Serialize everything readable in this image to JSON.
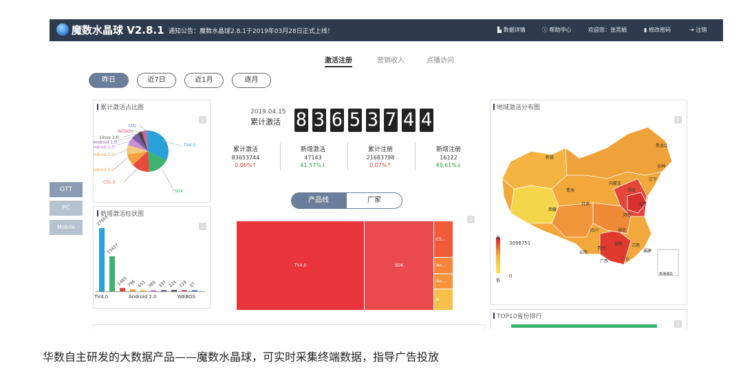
{
  "header": {
    "title": "魔数水晶球 V2.8.1",
    "notice": "通知公告：魔数水晶球2.8.1于2019年03月28日正式上线！",
    "nav": [
      "数据详情",
      "帮助中心",
      "欢迎您：张莞娟",
      "修改密码",
      "注销"
    ]
  },
  "tabs": [
    "激活注册",
    "营销收入",
    "点播访问"
  ],
  "periods": [
    "昨日",
    "近7日",
    "近1月",
    "逐月"
  ],
  "side_tabs": [
    "OTT",
    "PC",
    "Mobile"
  ],
  "pie": {
    "title": "累计激活占比图",
    "labels": [
      "XML",
      "WEBOS",
      "Linux 1.0",
      "Android 1.0",
      "Android 1.3",
      "Android 2.0",
      "Android 3.0",
      "CS1.0",
      "SDK",
      "TV4.0"
    ]
  },
  "bars": {
    "title": "新增激活柱状图",
    "values": [
      "27655",
      "15437",
      "1483",
      "796",
      "651",
      "385",
      "337",
      "224",
      "119",
      "37"
    ],
    "x_labels": [
      "TV4.0",
      "Android 2.0",
      "WEBOS"
    ]
  },
  "counter": {
    "date": "2019.04.15",
    "label": "累计激活",
    "digits": [
      "8",
      "3",
      "6",
      "5",
      "3",
      "7",
      "4",
      "4"
    ]
  },
  "stats": [
    {
      "label": "累计激活",
      "value": "83653744",
      "pct": "0.06%↑"
    },
    {
      "label": "新增激活",
      "value": "47143",
      "pct": "41.57%↓"
    },
    {
      "label": "累计注册",
      "value": "21683798",
      "pct": "0.07%↑"
    },
    {
      "label": "新增注册",
      "value": "16122",
      "pct": "49.61%↓"
    }
  ],
  "toggle": [
    "产品线",
    "厂家"
  ],
  "treemap": [
    "TV4.0",
    "SDK",
    "CS...",
    "An...",
    "An...",
    "A"
  ],
  "map": {
    "title": "地域激活分布图",
    "legend_high": "高",
    "legend_max": "3098751",
    "legend_low": "低",
    "legend_min": "0",
    "inset": "南海诸岛",
    "provinces": [
      "新疆",
      "西藏",
      "青海",
      "甘肃",
      "四川",
      "云南",
      "内蒙古",
      "黑龙江",
      "吉林",
      "辽宁",
      "河北",
      "山东",
      "河南",
      "湖北",
      "湖南",
      "广东",
      "广西",
      "江西",
      "福建",
      "贵州"
    ]
  },
  "top10": {
    "title": "TOP10省份排行"
  },
  "caption": "华数自主研发的大数据产品——魔数水晶球，可实时采集终端数据，指导广告投放",
  "colors": {
    "header": "#2e3b4e",
    "accent": "#6b7e99",
    "up": "#e03c31",
    "down": "#2a9d3a"
  }
}
